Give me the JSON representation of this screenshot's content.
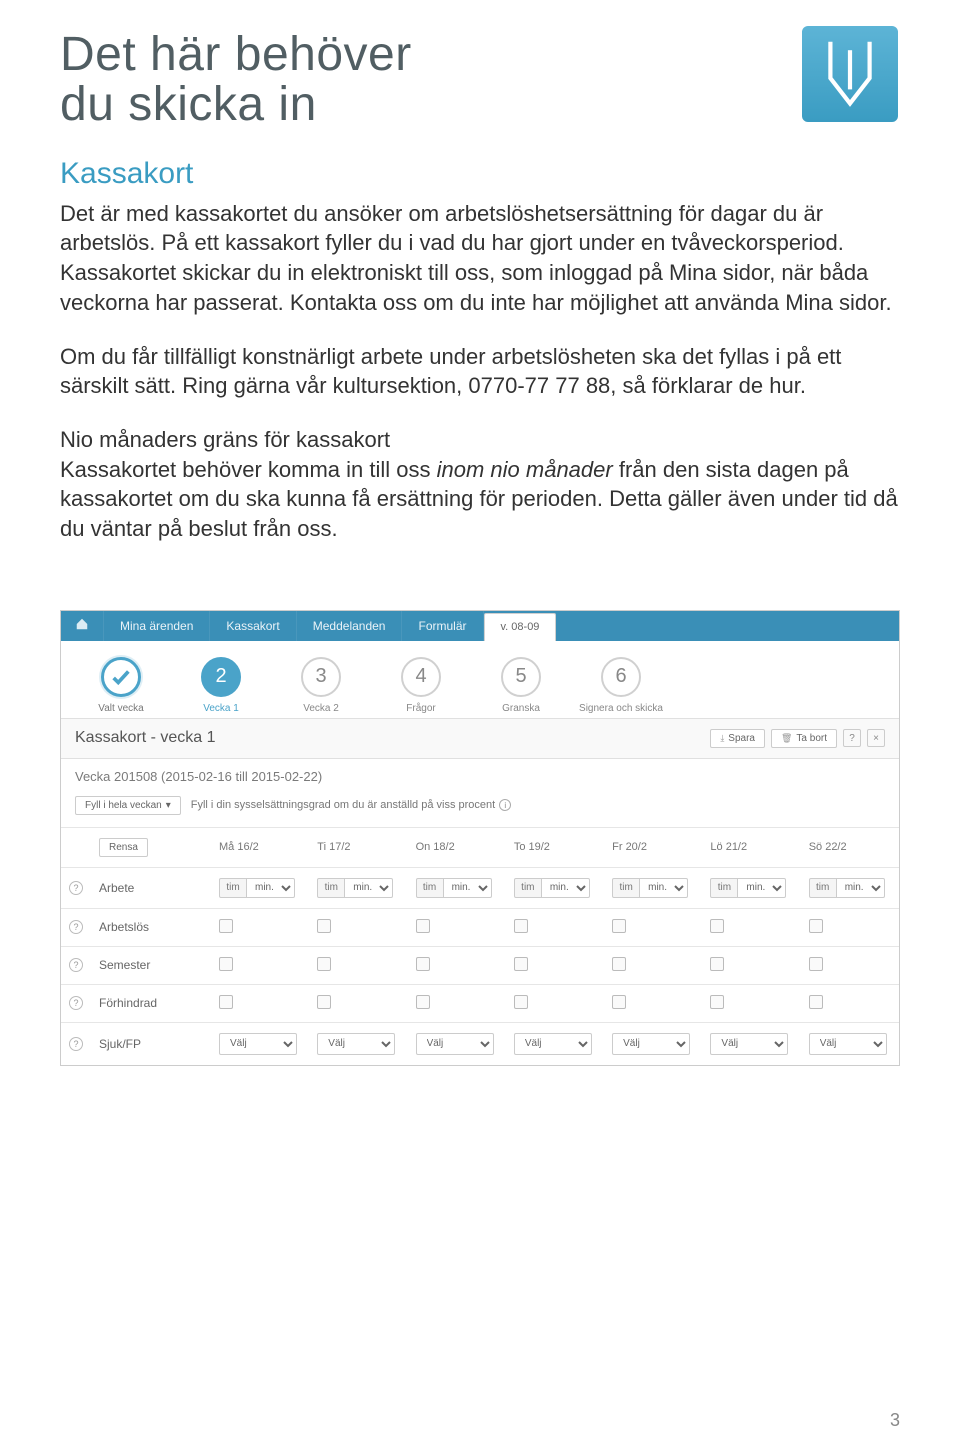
{
  "heading": "Det här behöver\ndu skicka in",
  "section_title": "Kassakort",
  "para1": "Det är med kassakortet du ansöker om arbetslöshetsersättning för dagar du är arbetslös. På ett kassakort fyller du i vad du har gjort under en tvåveckorsperiod. Kassakortet skickar du in elektroniskt till oss, som inloggad på Mina sidor, när båda veckorna har passerat. Kontakta oss om du inte har möjlighet att använda Mina sidor.",
  "para2": "Om du får tillfälligt konstnärligt arbete under arbetslösheten ska det fyllas i på ett särskilt sätt. Ring gärna vår kultursektion, 0770-77 77 88, så förklarar de hur.",
  "para3_bold": "Nio månaders gräns för kassakort",
  "para3_a": "Kassakortet behöver komma in till oss ",
  "para3_ital": "inom nio månader",
  "para3_b": " från den sista dagen på kassakortet om du ska kunna få ersättning för perioden. Detta gäller även under tid då du väntar på beslut från oss.",
  "page_number": "3",
  "app": {
    "nav": [
      "Mina ärenden",
      "Kassakort",
      "Meddelanden",
      "Formulär"
    ],
    "active_tab": "v. 08-09",
    "steps": [
      {
        "label": "Valt vecka",
        "state": "done"
      },
      {
        "num": "2",
        "label": "Vecka 1",
        "state": "active"
      },
      {
        "num": "3",
        "label": "Vecka 2",
        "state": ""
      },
      {
        "num": "4",
        "label": "Frågor",
        "state": ""
      },
      {
        "num": "5",
        "label": "Granska",
        "state": ""
      },
      {
        "num": "6",
        "label": "Signera och skicka",
        "state": ""
      }
    ],
    "panel_title": "Kassakort - vecka 1",
    "btn_save": "Spara",
    "btn_delete": "Ta bort",
    "week_range": "Vecka 201508 (2015-02-16 till 2015-02-22)",
    "fill_week": "Fyll i hela veckan",
    "hint": "Fyll i din sysselsättningsgrad om du är anställd på viss procent",
    "btn_clear": "Rensa",
    "days": [
      "Må 16/2",
      "Ti 17/2",
      "On 18/2",
      "To 19/2",
      "Fr 20/2",
      "Lö 21/2",
      "Sö 22/2"
    ],
    "rows": {
      "arbete": "Arbete",
      "arbetslos": "Arbetslös",
      "semester": "Semester",
      "forhindrad": "Förhindrad",
      "sjuk": "Sjuk/FP"
    },
    "time_placeholder": "tim",
    "time_unit": "min.",
    "select_placeholder": "Välj"
  }
}
